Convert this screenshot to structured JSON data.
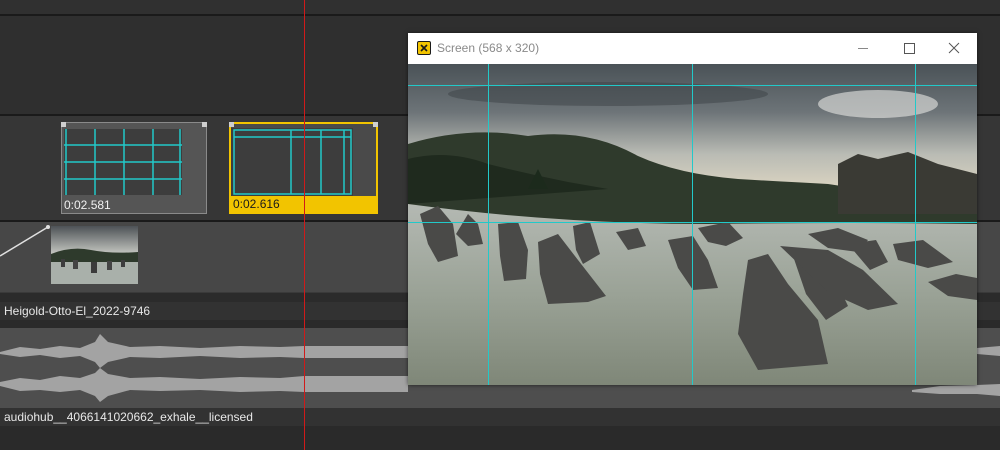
{
  "timeline": {
    "transition_clips": [
      {
        "timecode": "0:02.581",
        "selected": false
      },
      {
        "timecode": "0:02.616",
        "selected": true
      }
    ],
    "video_track": {
      "clip_name": "Heigold-Otto-El_2022-9746"
    },
    "audio_track": {
      "clip_name": "audiohub__4066141020662_exhale__licensed"
    }
  },
  "preview_window": {
    "title": "Screen (568 x 320)",
    "buttons": [
      "minimize",
      "maximize",
      "close"
    ]
  },
  "colors": {
    "accent": "#f2c400",
    "playhead": "#d01a1a",
    "guide": "#22c9c9",
    "background": "#2b2b2b"
  },
  "icons": [
    "app-icon",
    "minimize-icon",
    "maximize-icon",
    "close-icon"
  ]
}
